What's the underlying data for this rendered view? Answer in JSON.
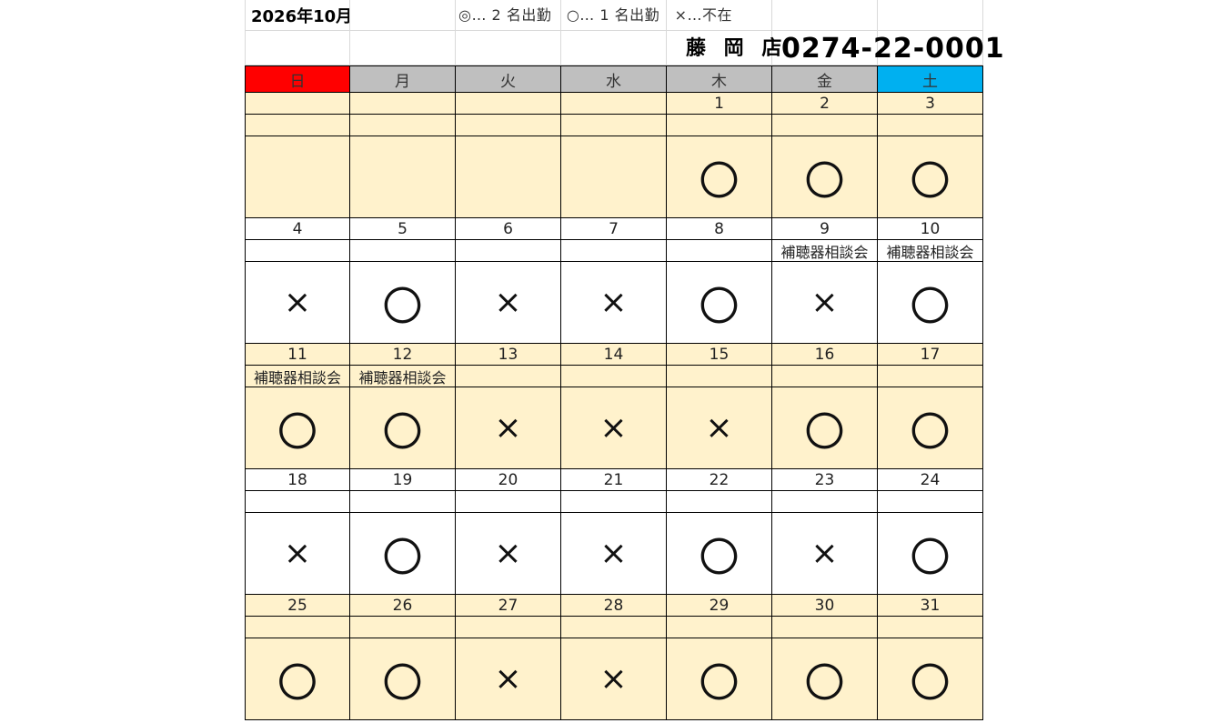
{
  "header": {
    "month_title": "2026年10月",
    "legend": "◎… 2 名出勤　○… 1 名出勤　×…不在",
    "store_name": "藤 岡 店",
    "phone": "0274-22-0001"
  },
  "weekdays": [
    "日",
    "月",
    "火",
    "水",
    "木",
    "金",
    "土"
  ],
  "weeks": [
    {
      "shaded": true,
      "days": [
        {
          "num": "",
          "event": "",
          "mark": ""
        },
        {
          "num": "",
          "event": "",
          "mark": ""
        },
        {
          "num": "",
          "event": "",
          "mark": ""
        },
        {
          "num": "",
          "event": "",
          "mark": ""
        },
        {
          "num": "1",
          "event": "",
          "mark": "〇"
        },
        {
          "num": "2",
          "event": "",
          "mark": "〇"
        },
        {
          "num": "3",
          "event": "",
          "mark": "〇"
        }
      ]
    },
    {
      "shaded": false,
      "days": [
        {
          "num": "4",
          "event": "",
          "mark": "×"
        },
        {
          "num": "5",
          "event": "",
          "mark": "〇"
        },
        {
          "num": "6",
          "event": "",
          "mark": "×"
        },
        {
          "num": "7",
          "event": "",
          "mark": "×"
        },
        {
          "num": "8",
          "event": "",
          "mark": "〇"
        },
        {
          "num": "9",
          "event": "補聴器相談会",
          "mark": "×"
        },
        {
          "num": "10",
          "event": "補聴器相談会",
          "mark": "〇"
        }
      ]
    },
    {
      "shaded": true,
      "days": [
        {
          "num": "11",
          "event": "補聴器相談会",
          "mark": "〇"
        },
        {
          "num": "12",
          "event": "補聴器相談会",
          "mark": "〇"
        },
        {
          "num": "13",
          "event": "",
          "mark": "×"
        },
        {
          "num": "14",
          "event": "",
          "mark": "×"
        },
        {
          "num": "15",
          "event": "",
          "mark": "×"
        },
        {
          "num": "16",
          "event": "",
          "mark": "〇"
        },
        {
          "num": "17",
          "event": "",
          "mark": "〇"
        }
      ]
    },
    {
      "shaded": false,
      "days": [
        {
          "num": "18",
          "event": "",
          "mark": "×"
        },
        {
          "num": "19",
          "event": "",
          "mark": "〇"
        },
        {
          "num": "20",
          "event": "",
          "mark": "×"
        },
        {
          "num": "21",
          "event": "",
          "mark": "×"
        },
        {
          "num": "22",
          "event": "",
          "mark": "〇"
        },
        {
          "num": "23",
          "event": "",
          "mark": "×"
        },
        {
          "num": "24",
          "event": "",
          "mark": "〇"
        }
      ]
    },
    {
      "shaded": true,
      "days": [
        {
          "num": "25",
          "event": "",
          "mark": "〇"
        },
        {
          "num": "26",
          "event": "",
          "mark": "〇"
        },
        {
          "num": "27",
          "event": "",
          "mark": "×"
        },
        {
          "num": "28",
          "event": "",
          "mark": "×"
        },
        {
          "num": "29",
          "event": "",
          "mark": "〇"
        },
        {
          "num": "30",
          "event": "",
          "mark": "〇"
        },
        {
          "num": "31",
          "event": "",
          "mark": "〇"
        }
      ]
    }
  ],
  "colors": {
    "sunday_header": "#ff0000",
    "saturday_header": "#00b0f0",
    "weekday_header": "#bfbfbf",
    "shaded_week": "#fff2cc"
  }
}
